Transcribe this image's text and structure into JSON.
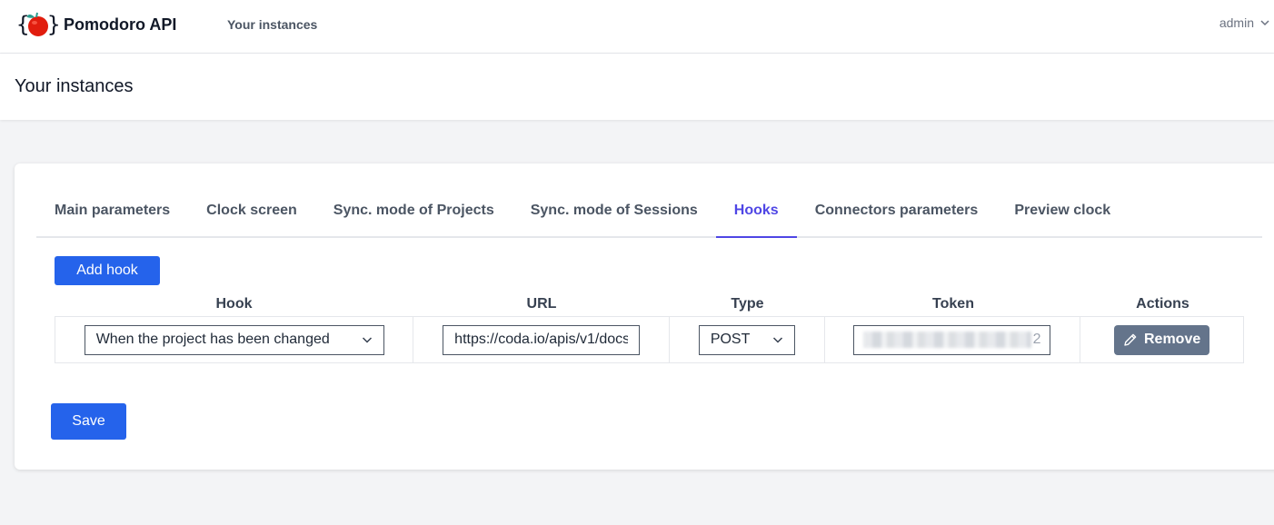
{
  "app": {
    "name": "Pomodoro API",
    "nav_link": "Your instances",
    "user": "admin"
  },
  "page": {
    "title": "Your instances"
  },
  "tabs": [
    {
      "label": "Main parameters",
      "active": false
    },
    {
      "label": "Clock screen",
      "active": false
    },
    {
      "label": "Sync. mode of Projects",
      "active": false
    },
    {
      "label": "Sync. mode of Sessions",
      "active": false
    },
    {
      "label": "Hooks",
      "active": true
    },
    {
      "label": "Connectors parameters",
      "active": false
    },
    {
      "label": "Preview clock",
      "active": false
    }
  ],
  "hooks": {
    "add_label": "Add hook",
    "columns": [
      "Hook",
      "URL",
      "Type",
      "Token",
      "Actions"
    ],
    "rows": [
      {
        "hook": "When the project has been changed",
        "url": "https://coda.io/apis/v1/docs",
        "type": "POST",
        "token_suffix": "2",
        "remove_label": "Remove"
      }
    ]
  },
  "save_label": "Save",
  "colors": {
    "primary": "#2563eb",
    "active_tab": "#4f46e5",
    "remove_button": "#64748b",
    "logo_tomato": "#e11d0e",
    "logo_leaf": "#2a9d8f"
  },
  "icons": {
    "logo": "tomato-braces-logo",
    "user_menu": "chevron-down-icon",
    "select": "chevron-down-icon",
    "remove": "pencil-icon"
  }
}
